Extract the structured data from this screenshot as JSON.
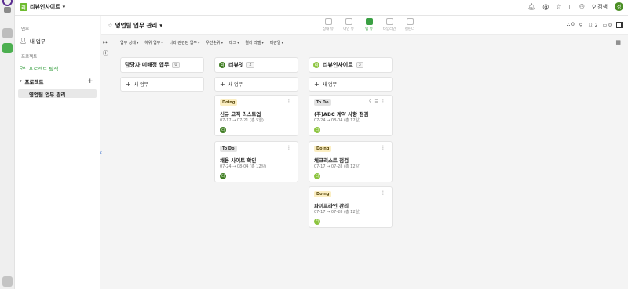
{
  "workspace": {
    "name": "리뷰인사이트",
    "logo_letter": "리"
  },
  "topbar": {
    "search_label": "검색",
    "user_initial": "정"
  },
  "sidebar": {
    "section_work": "업무",
    "my_tasks": "내 업무",
    "section_projects": "프로젝트",
    "project_explore": "프로젝트 탐색",
    "project_explore_icon_text": "QA",
    "projects_group": "프로젝트",
    "current_project": "영업팀 업무 관리"
  },
  "header": {
    "title": "영업팀 업무 관리",
    "views": [
      {
        "label": "상태 뷰"
      },
      {
        "label": "여인 뷰"
      },
      {
        "label": "팀 뷰"
      },
      {
        "label": "타임라인"
      },
      {
        "label": "캘린더"
      }
    ],
    "stats": {
      "tasks": "0",
      "members": "2",
      "files": "0"
    }
  },
  "filters": [
    "업무 상태",
    "하위 업무",
    "나와 관련된 업무",
    "우선순위",
    "태그",
    "컬러 라벨",
    "마감일"
  ],
  "columns": [
    {
      "title": "담당자 미배정 업무",
      "count": "0",
      "add_label": "새 업무",
      "avatar": "",
      "cards": []
    },
    {
      "title": "리뷰잇",
      "count": "2",
      "add_label": "새 업무",
      "avatar": "리",
      "cards": [
        {
          "status": "Doing",
          "name": "신규 고객 리스트업",
          "date": "07-17 → 07-21 (총 5일)",
          "assignee": "리"
        },
        {
          "status": "To Do",
          "name": "채용 사이트 확인",
          "date": "07-24 → 08-04 (총 12일)",
          "assignee": "리"
        }
      ]
    },
    {
      "title": "리뷰인사이트",
      "count": "3",
      "add_label": "새 업무",
      "avatar": "리",
      "cards": [
        {
          "status": "To Do",
          "name": "(주)ABC 계약 사항 점검",
          "date": "07-24 → 08-04 (총 12일)",
          "assignee": "리"
        },
        {
          "status": "Doing",
          "name": "체크리스트 점검",
          "date": "07-17 → 07-28 (총 12일)",
          "assignee": "리"
        },
        {
          "status": "Doing",
          "name": "파이프라인 관리",
          "date": "07-17 → 07-28 (총 12일)",
          "assignee": "리"
        }
      ]
    }
  ],
  "colors": {
    "accent": "#3aa043",
    "doing_bg": "#fbeec2",
    "todo_bg": "#e3e3e3",
    "brand": "#6dbb2e"
  }
}
